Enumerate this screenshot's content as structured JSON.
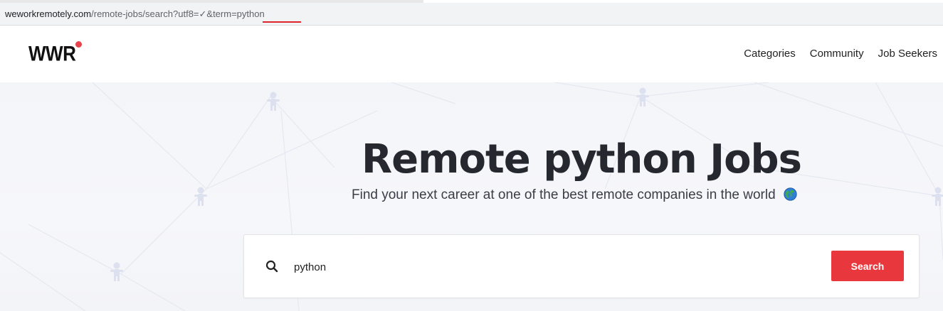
{
  "browser": {
    "url_host": "weworkremotely.com",
    "url_path": "/remote-jobs/search?utf8=✓&term=python"
  },
  "header": {
    "logo_text": "WWR",
    "nav": [
      {
        "label": "Categories"
      },
      {
        "label": "Community"
      },
      {
        "label": "Job Seekers"
      }
    ]
  },
  "hero": {
    "title": "Remote python Jobs",
    "subtitle": "Find your next career at one of the best remote companies in the world",
    "subtitle_icon": "globe-icon"
  },
  "search": {
    "value": "python",
    "button_label": "Search"
  },
  "colors": {
    "accent": "#e8383d",
    "logo_dot": "#e8424a"
  }
}
